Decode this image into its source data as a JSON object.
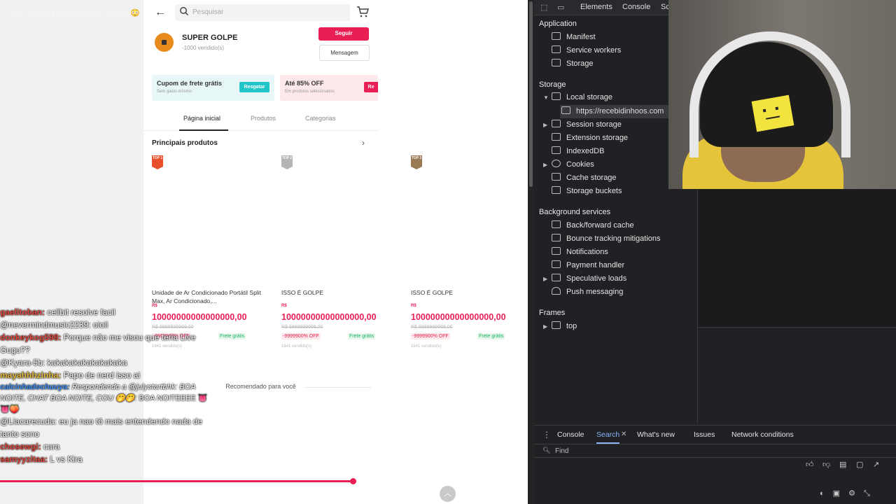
{
  "stream": {
    "title": "H4CK3ANDO GOLPES do TikTok 😳"
  },
  "shop": {
    "search_placeholder": "Pesquisar",
    "store_name": "SUPER GOLPE",
    "store_sold": "-1000 vendido(s)",
    "follow_label": "Seguir",
    "message_label": "Mensagem",
    "coupons": [
      {
        "title": "Cupom de frete grátis",
        "subtitle": "Sem gasto mínimo",
        "button": "Resgatar"
      },
      {
        "title": "Até 85% OFF",
        "subtitle": "Em produtos selecionados",
        "button": "Re"
      }
    ],
    "tabs": [
      "Página inicial",
      "Produtos",
      "Categorias"
    ],
    "section_title": "Principais produtos",
    "products": [
      {
        "badge": "TOP 1",
        "title": "Unidade de Ar Condicionado Portátil Split Max, Ar Condicionado,...",
        "currency": "R$",
        "price": "10000000000000000,00",
        "original": "R$ 9999999999,00",
        "discount": "-9999900% OFF",
        "shipping": "Frete grátis",
        "sold": "1641 vendido(s)"
      },
      {
        "badge": "TOP 2",
        "title": "ISSO É GOLPE",
        "currency": "R$",
        "price": "10000000000000000,00",
        "original": "R$ 9999999999,00",
        "discount": "-9999900% OFF",
        "shipping": "Frete grátis",
        "sold": "1641 vendido(s)"
      },
      {
        "badge": "TOP 3",
        "title": "ISSO É GOLPE",
        "currency": "R$",
        "price": "10000000000000000,00",
        "original": "R$ 9999999999,00",
        "discount": "-9999900% OFF",
        "shipping": "Frete grátis",
        "sold": "1641 vendido(s)"
      }
    ],
    "recommended": "Recomendado para você"
  },
  "chat": [
    {
      "user": "gaelitoban:",
      "text": "cellbit resolve facil",
      "color": "#e2483d"
    },
    {
      "user": "",
      "text": "@nevermindmusic2239: oioii",
      "color": "#ffffff"
    },
    {
      "user": "donkeykog598:",
      "text": "Porque não me visou que teria Live Gugu??",
      "color": "#e2483d"
    },
    {
      "user": "",
      "text": "@Kyara-5b: kakakakakakakakaka",
      "color": "#ffffff"
    },
    {
      "user": "mayahhhzinha:",
      "text": "Papo de nerd isso ai",
      "color": "#e6b93a"
    },
    {
      "user": "calcinhadochuuya:",
      "reply": "Respondendo a @julystartbhk: BOA NOITE, CHAT BOA NOITE, COU 🤭🤭:",
      "text": "BOA NOITEEEE 👅👅🍑",
      "color": "#3b8cf5"
    },
    {
      "user": "",
      "text": "@Liacarecuda: eu ja nao tô mais entendendo nada de tanto sono",
      "color": "#ffffff"
    },
    {
      "user": "chosewgi:",
      "text": "cara",
      "color": "#e2483d"
    },
    {
      "user": "samyyzitaa:",
      "text": "L vs Kira",
      "color": "#e2483d"
    }
  ],
  "progress": 0.67,
  "devtools": {
    "tabs": [
      "Elements",
      "Console",
      "Sc"
    ],
    "sections": {
      "application": "Application",
      "storage": "Storage",
      "background": "Background services",
      "frames": "Frames"
    },
    "application_items": [
      "Manifest",
      "Service workers",
      "Storage"
    ],
    "storage_items": [
      "Local storage",
      "Session storage",
      "Extension storage",
      "IndexedDB",
      "Cookies",
      "Cache storage",
      "Storage buckets"
    ],
    "local_storage_origin": "https://recebidinhoos.com",
    "background_items": [
      "Back/forward cache",
      "Bounce tracking mitigations",
      "Notifications",
      "Payment handler",
      "Speculative loads",
      "Push messaging"
    ],
    "frames_items": [
      "top"
    ],
    "drawer_tabs": [
      "Console",
      "Search",
      "What's new",
      "Issues",
      "Network conditions"
    ],
    "find_placeholder": "Find"
  }
}
